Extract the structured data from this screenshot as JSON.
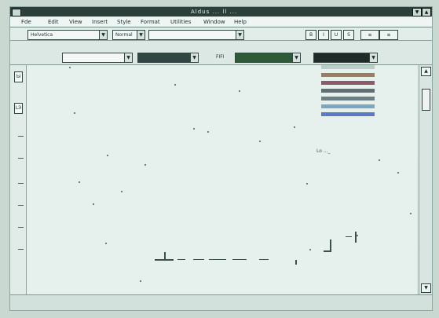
{
  "window": {
    "title": "Aldus ... ll ..."
  },
  "menubar": {
    "items": [
      {
        "label": "Fde",
        "icon": "file-menu"
      },
      {
        "label": "Edit",
        "icon": "edit-menu"
      },
      {
        "label": "View",
        "icon": "view-menu"
      },
      {
        "label": "Insert",
        "icon": "insert-menu"
      },
      {
        "label": "Style",
        "icon": "style-menu"
      },
      {
        "label": "Format",
        "icon": "format-menu"
      },
      {
        "label": "Utilities",
        "icon": "utilities-menu"
      },
      {
        "label": "Window",
        "icon": "window-menu"
      },
      {
        "label": "Help",
        "icon": "help-menu"
      }
    ]
  },
  "toolbar1": {
    "font_combo": "Helvetica",
    "style_combo": "Normal",
    "size_combo": "",
    "button_labels": [
      "B",
      "I",
      "U",
      "S"
    ]
  },
  "toolbar2": {
    "fill_label": "",
    "line_label": "FIFI",
    "color_label": ""
  },
  "colorpanel": {
    "colors": [
      "#b7cfc8",
      "#9c7e5e",
      "#8f5a68",
      "#5f6f72",
      "#6a7f86",
      "#7da7bf",
      "#5c78c7"
    ]
  },
  "left_tools": {
    "tool_1": "Ы",
    "tool_2": "LЭ"
  },
  "panel_label": "Lo ..._",
  "statusbar": {
    "left": "",
    "middle": "",
    "right": ""
  },
  "colors": {
    "titlebar": "#2d3f3a",
    "screen_bg": "#dfe9e4",
    "outline": "#324642"
  }
}
